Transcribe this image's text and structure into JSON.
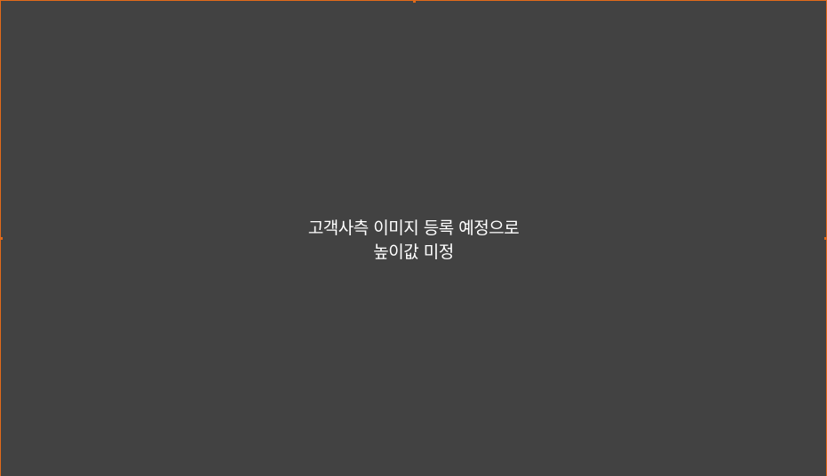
{
  "placeholder": {
    "line1": "고객사측 이미지 등록 예정으로",
    "line2": "높이값 미정",
    "background_color": "#424242",
    "border_color": "#e06a1a",
    "text_color": "#ffffff"
  }
}
